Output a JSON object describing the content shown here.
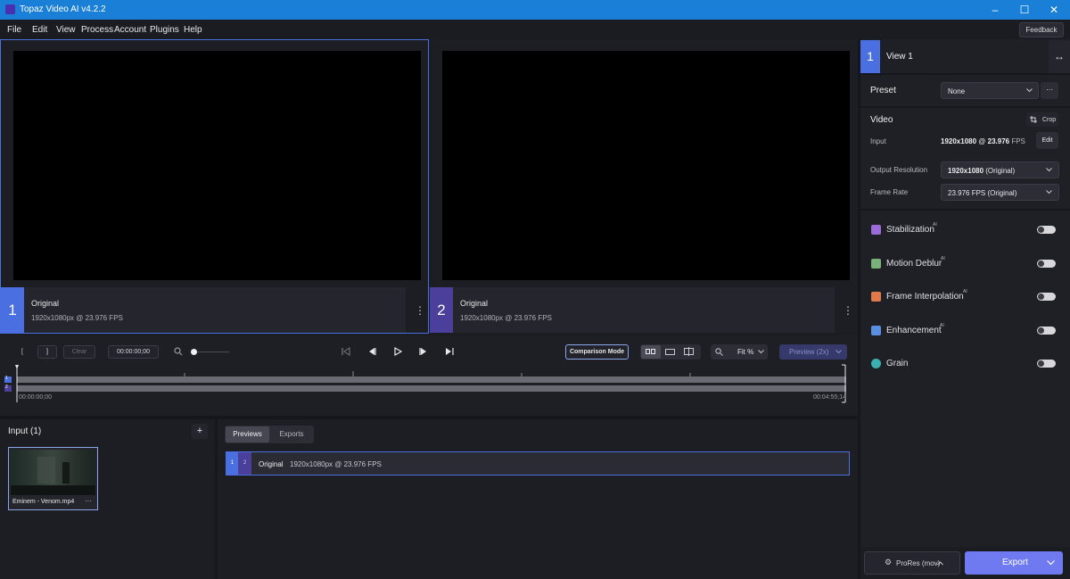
{
  "titlebar": {
    "title": "Topaz Video AI  v4.2.2",
    "minimize": "–",
    "maximize": "☐",
    "close": "✕"
  },
  "menu": [
    "File",
    "Edit",
    "View",
    "Process",
    "Account",
    "Plugins",
    "Help"
  ],
  "feedback": "Feedback",
  "viewers": [
    {
      "number": "1",
      "label": "Original",
      "info": "1920x1080px @ 23.976 FPS"
    },
    {
      "number": "2",
      "label": "Original",
      "info": "1920x1080px @ 23.976 FPS"
    }
  ],
  "controls": {
    "mark_in": "[",
    "mark_out": "]",
    "clear": "Clear",
    "timecode": "00:00:00;00",
    "comparison": "Comparison Mode",
    "fit": "Fit %",
    "preview": "Preview (2x)"
  },
  "timeline": {
    "start": "00:00:00;00",
    "end": "00:04:55;14",
    "track1": "1",
    "track2": "2"
  },
  "input": {
    "title": "Input (1)",
    "add": "+",
    "thumb_name": "Eminem - Venom.mp4",
    "thumb_menu": "···"
  },
  "tabs": {
    "previews": "Previews",
    "exports": "Exports"
  },
  "preview_row": {
    "n1": "1",
    "n2": "2",
    "label": "Original",
    "info": "1920x1080px @ 23.976 FPS"
  },
  "sidebar": {
    "view_number": "1",
    "view_label": "View 1",
    "preset_label": "Preset",
    "preset_value": "None",
    "more": "···",
    "video_label": "Video",
    "crop": "Crop",
    "input_label": "Input",
    "input_res": "1920x1080",
    "input_at": " @ ",
    "input_fps": "23.976",
    "input_fps_unit": " FPS",
    "edit": "Edit",
    "output_res_label": "Output Resolution",
    "output_res_bold": "1920x1080",
    "output_res_rest": " (Original)",
    "frame_rate_label": "Frame Rate",
    "frame_rate_value": "23.976 FPS (Original)",
    "filters": [
      {
        "name": "Stabilization",
        "ai": "AI",
        "color": "#9b6cd8"
      },
      {
        "name": "Motion Deblur",
        "ai": "AI",
        "color": "#7ab07a"
      },
      {
        "name": "Frame Interpolation",
        "ai": "AI",
        "color": "#e07a4a"
      },
      {
        "name": "Enhancement",
        "ai": "AI",
        "color": "#5a8ee0"
      },
      {
        "name": "Grain",
        "ai": "",
        "color": "#3ab0b0"
      }
    ],
    "format": "ProRes (mov)",
    "export": "Export"
  },
  "colors": {
    "accent": "#4a6fe0",
    "view2": "#4a3f9a",
    "export": "#6f7af0"
  }
}
